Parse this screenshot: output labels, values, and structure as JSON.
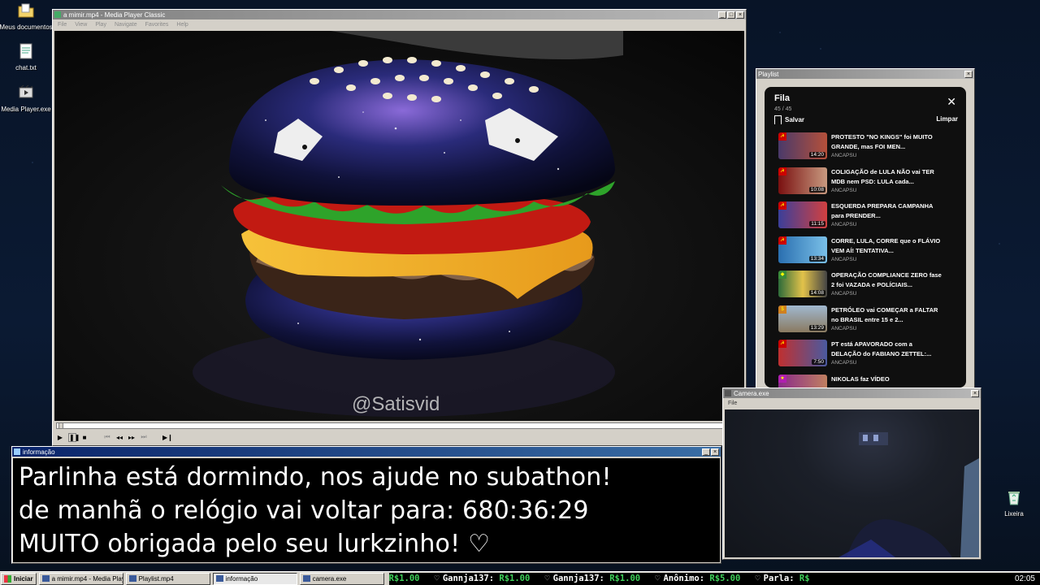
{
  "desktop": {
    "icons": [
      {
        "label": "Meus documentos",
        "icon": "folder-icon"
      },
      {
        "label": "chat.txt",
        "icon": "text-file-icon"
      },
      {
        "label": "Media Player.exe",
        "icon": "media-player-icon"
      },
      {
        "label": "Lixeira",
        "icon": "recycle-bin-icon"
      }
    ]
  },
  "mpc": {
    "title": "a mimir.mp4 - Media Player Classic",
    "menu": [
      "File",
      "View",
      "Play",
      "Navigate",
      "Favorites",
      "Help"
    ],
    "watermark": "@Satisvid",
    "seek_progress": 0.0
  },
  "playlist": {
    "window_title": "Playlist",
    "title": "Fila",
    "count": "45 / 45",
    "save_label": "Salvar",
    "clear_label": "Limpar",
    "items": [
      {
        "title": "PROTESTO \"NO KINGS\" foi MUITO GRANDE, mas FOI MEN...",
        "channel": "ANCAPSU",
        "duration": "14:20"
      },
      {
        "title": "COLIGAÇÃO de LULA NÃO vai TER MDB nem PSD: LULA cada...",
        "channel": "ANCAPSU",
        "duration": "10:08"
      },
      {
        "title": "ESQUERDA PREPARA CAMPANHA para PRENDER...",
        "channel": "ANCAPSU",
        "duration": "11:15"
      },
      {
        "title": "CORRE, LULA, CORRE que o FLÁVIO VEM AÍ! TENTATIVA...",
        "channel": "ANCAPSU",
        "duration": "13:34"
      },
      {
        "title": "OPERAÇÃO COMPLIANCE ZERO fase 2 foi VAZADA e POLÍCIAIS...",
        "channel": "ANCAPSU",
        "duration": "14:08"
      },
      {
        "title": "PETRÓLEO vai COMEÇAR a FALTAR no BRASIL entre 15 e 2...",
        "channel": "ANCAPSU",
        "duration": "13:29"
      },
      {
        "title": "PT está APAVORADO com a DELAÇÃO do FABIANO ZETTEL:...",
        "channel": "ANCAPSU",
        "duration": "7:50"
      },
      {
        "title": "NIKOLAS faz VÍDEO",
        "channel": "",
        "duration": ""
      }
    ]
  },
  "info": {
    "window_title": "informação",
    "lines": [
      "Parlinha está dormindo, nos ajude no subathon!",
      "de manhã o relógio vai voltar para:  680:36:29",
      "MUITO obrigada pelo seu lurkzinho! ♡"
    ]
  },
  "camera": {
    "window_title": "Camera.exe",
    "menu_file": "File"
  },
  "taskbar": {
    "start_label": "Iniciar",
    "tasks": [
      {
        "label": "a mimir.mp4 - Media Playe...",
        "active": false
      },
      {
        "label": "Playlist.mp4",
        "active": false
      },
      {
        "label": "informação",
        "active": true
      },
      {
        "label": "camera.exe",
        "active": false
      }
    ],
    "ticker": [
      {
        "name": "",
        "amount": "R$1.00"
      },
      {
        "name": "Gannja137:",
        "amount": "R$1.00"
      },
      {
        "name": "Gannja137:",
        "amount": "R$1.00"
      },
      {
        "name": "Anônimo:",
        "amount": "R$5.00"
      },
      {
        "name": "Parla:",
        "amount": "R$"
      }
    ],
    "clock": "02:05"
  },
  "colors": {
    "ticker_amount": "#3fd15a",
    "titlebar_active": "#0a246a",
    "yt_bg": "#0f0f0f"
  }
}
